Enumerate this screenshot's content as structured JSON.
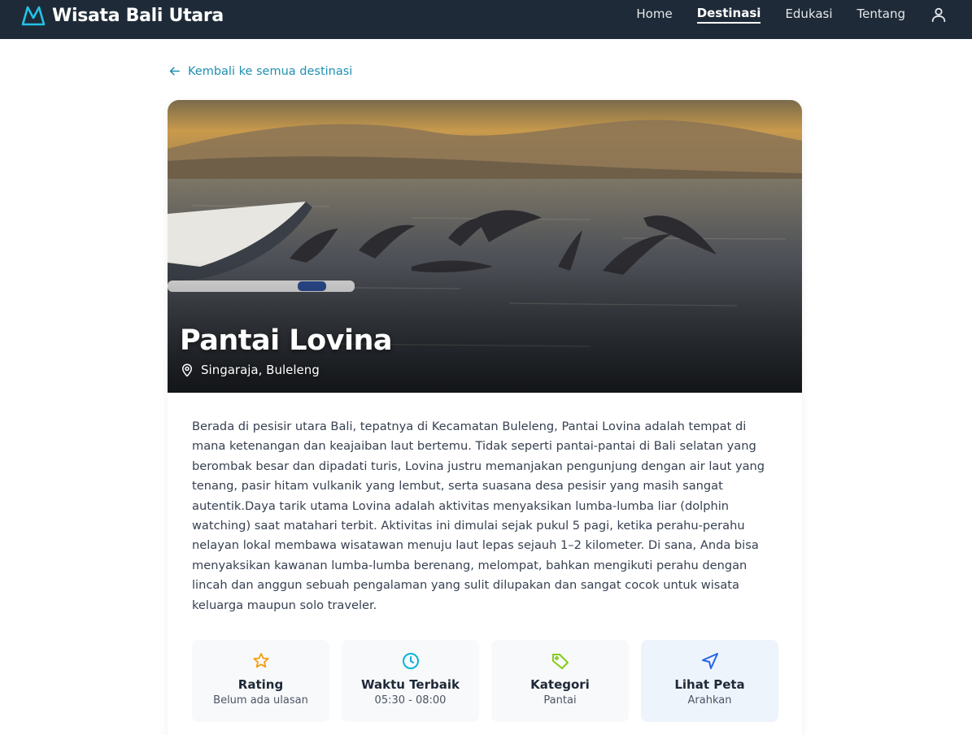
{
  "nav": {
    "brand": "Wisata Bali Utara",
    "links": [
      {
        "label": "Home",
        "active": false
      },
      {
        "label": "Destinasi",
        "active": true
      },
      {
        "label": "Edukasi",
        "active": false
      },
      {
        "label": "Tentang",
        "active": false
      }
    ],
    "user_icon": "user-icon"
  },
  "back_link": "Kembali ke semua destinasi",
  "destination": {
    "title": "Pantai Lovina",
    "location": "Singaraja, Buleleng",
    "description": "Berada di pesisir utara Bali, tepatnya di Kecamatan Buleleng, Pantai Lovina adalah tempat di mana ketenangan dan keajaiban laut bertemu. Tidak seperti pantai-pantai di Bali selatan yang berombak besar dan dipadati turis, Lovina justru memanjakan pengunjung dengan air laut yang tenang, pasir hitam vulkanik yang lembut, serta suasana desa pesisir yang masih sangat autentik.Daya tarik utama Lovina adalah aktivitas menyaksikan lumba-lumba liar (dolphin watching) saat matahari terbit. Aktivitas ini dimulai sejak pukul 5 pagi, ketika perahu-perahu nelayan lokal membawa wisatawan menuju laut lepas sejauh 1–2 kilometer. Di sana, Anda bisa menyaksikan kawanan lumba-lumba berenang, melompat, bahkan mengikuti perahu dengan lincah dan anggun sebuah pengalaman yang sulit dilupakan dan sangat cocok untuk wisata keluarga maupun solo traveler."
  },
  "info": [
    {
      "title": "Rating",
      "sub": "Belum ada ulasan",
      "icon": "star-icon",
      "color": "#f59e0b"
    },
    {
      "title": "Waktu Terbaik",
      "sub": "05:30 - 08:00",
      "icon": "clock-icon",
      "color": "#06b6d4"
    },
    {
      "title": "Kategori",
      "sub": "Pantai",
      "icon": "tag-icon",
      "color": "#84cc16"
    },
    {
      "title": "Lihat Peta",
      "sub": "Arahkan",
      "icon": "navigation-icon",
      "color": "#2563eb"
    }
  ],
  "colors": {
    "navbar": "#1e2a38",
    "accent": "#1f8fb0",
    "logo": "#22c3e6"
  }
}
